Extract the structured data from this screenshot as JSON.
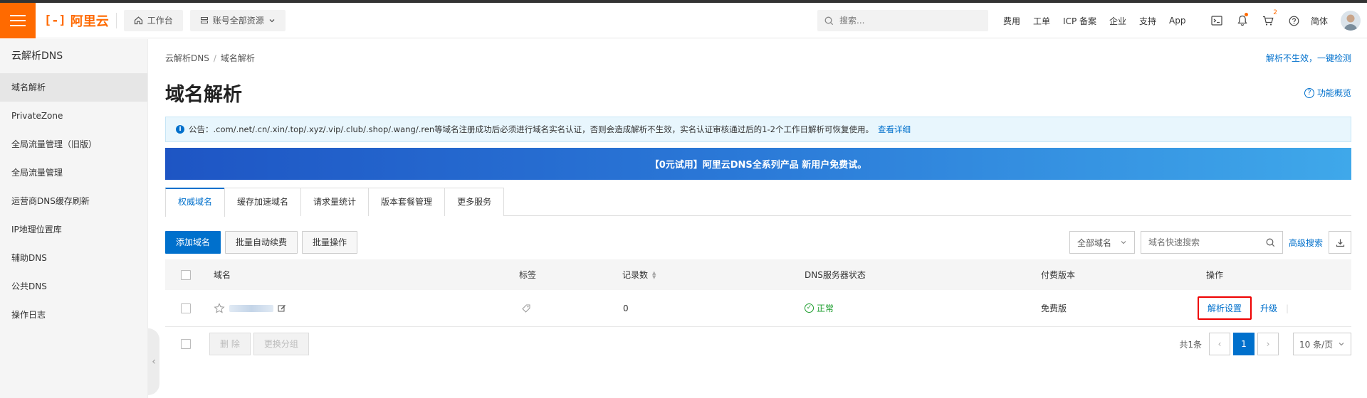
{
  "topbar": {
    "logo": "阿里云",
    "workbench": "工作台",
    "resources": "账号全部资源",
    "search_placeholder": "搜索...",
    "links": [
      "费用",
      "工单",
      "ICP 备案",
      "企业",
      "支持",
      "App"
    ],
    "cart_badge": "2",
    "language": "简体"
  },
  "sidebar": {
    "title": "云解析DNS",
    "items": [
      {
        "label": "域名解析",
        "active": true
      },
      {
        "label": "PrivateZone",
        "active": false
      },
      {
        "label": "全局流量管理（旧版）",
        "active": false
      },
      {
        "label": "全局流量管理",
        "active": false
      },
      {
        "label": "运营商DNS缓存刷新",
        "active": false
      },
      {
        "label": "IP地理位置库",
        "active": false
      },
      {
        "label": "辅助DNS",
        "active": false
      },
      {
        "label": "公共DNS",
        "active": false
      },
      {
        "label": "操作日志",
        "active": false
      }
    ]
  },
  "breadcrumb": [
    "云解析DNS",
    "域名解析"
  ],
  "detect_link": "解析不生效，一键检测",
  "page_title": "域名解析",
  "features_link": "功能概览",
  "notice": {
    "text": "公告：.com/.net/.cn/.xin/.top/.xyz/.vip/.club/.shop/.wang/.ren等域名注册成功后必须进行域名实名认证，否则会造成解析不生效，实名认证审核通过后的1-2个工作日解析可恢复使用。",
    "link": "查看详细"
  },
  "banner": "【0元试用】阿里云DNS全系列产品 新用户免费试。",
  "tabs": [
    "权威域名",
    "缓存加速域名",
    "请求量统计",
    "版本套餐管理",
    "更多服务"
  ],
  "toolbar": {
    "add": "添加域名",
    "auto_renew": "批量自动续费",
    "batch": "批量操作",
    "domain_filter": "全部域名",
    "search_placeholder": "域名快速搜索",
    "advanced": "高级搜索"
  },
  "table": {
    "headers": {
      "domain": "域名",
      "tag": "标签",
      "records": "记录数",
      "dns_status": "DNS服务器状态",
      "edition": "付费版本",
      "actions": "操作"
    },
    "rows": [
      {
        "records": "0",
        "status": "正常",
        "edition": "免费版",
        "action_settings": "解析设置",
        "action_upgrade": "升级"
      }
    ]
  },
  "footer": {
    "delete": "删 除",
    "change_group": "更换分组",
    "total": "共1条",
    "page": "1",
    "page_size": "10 条/页"
  },
  "colors": {
    "brand": "#ff6a00",
    "link": "#0070cc",
    "ok": "#1a9c2b",
    "highlight": "#e00000"
  }
}
